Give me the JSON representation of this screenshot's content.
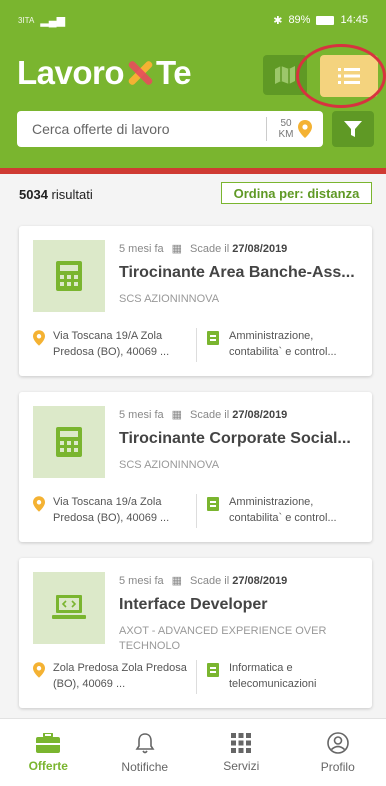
{
  "statusbar": {
    "operator": "3ITA",
    "battery": "89%",
    "time": "14:45"
  },
  "header": {
    "logo_part1": "Lavoro",
    "logo_part2": "Te",
    "search_placeholder": "Cerca offerte di lavoro",
    "distance_value": "50",
    "distance_unit": "KM"
  },
  "results": {
    "count": "5034",
    "count_label": " risultati",
    "sort_label": "Ordina per: distanza"
  },
  "jobs": [
    {
      "age": "5 mesi fa",
      "deadline_label": "Scade il",
      "deadline": "27/08/2019",
      "title": "Tirocinante Area Banche-Ass...",
      "company": "SCS AZIONINNOVA",
      "address": "Via Toscana 19/A Zola Predosa (BO), 40069 ...",
      "category": "Amministrazione, contabilita` e control...",
      "icon": "calculator-icon"
    },
    {
      "age": "5 mesi fa",
      "deadline_label": "Scade il",
      "deadline": "27/08/2019",
      "title": "Tirocinante Corporate Social...",
      "company": "SCS AZIONINNOVA",
      "address": "Via Toscana 19/a Zola Predosa (BO), 40069 ...",
      "category": "Amministrazione, contabilita` e control...",
      "icon": "calculator-icon"
    },
    {
      "age": "5 mesi fa",
      "deadline_label": "Scade il",
      "deadline": "27/08/2019",
      "title": "Interface Developer",
      "company": "AXOT - ADVANCED EXPERIENCE OVER TECHNOLO",
      "address": "Zola Predosa Zola Predosa (BO), 40069 ...",
      "category": "Informatica e telecomunicazioni",
      "icon": "laptop-code-icon"
    }
  ],
  "nav": [
    {
      "label": "Offerte",
      "icon": "briefcase-icon",
      "active": true
    },
    {
      "label": "Notifiche",
      "icon": "bell-icon",
      "active": false
    },
    {
      "label": "Servizi",
      "icon": "grid-icon",
      "active": false
    },
    {
      "label": "Profilo",
      "icon": "profile-icon",
      "active": false
    }
  ],
  "colors": {
    "brand_green": "#7ab52f",
    "dark_green": "#5f9925",
    "accent_yellow": "#f4d37e",
    "highlight_red": "#d7333f"
  }
}
